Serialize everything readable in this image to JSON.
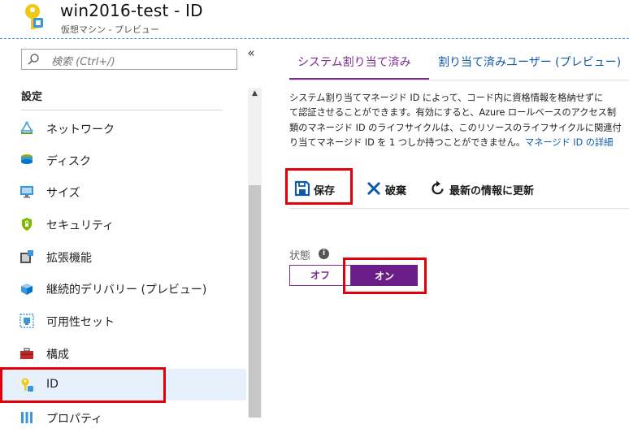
{
  "header": {
    "title": "win2016-test - ID",
    "subtitle": "仮想マシン - プレビュー",
    "icon": "key-identity-icon"
  },
  "sidebar": {
    "search_placeholder": "検索 (Ctrl+/)",
    "collapse_glyph": "«",
    "section_heading": "設定",
    "items": [
      {
        "label": "ネットワーク",
        "icon": "network-icon"
      },
      {
        "label": "ディスク",
        "icon": "disk-icon"
      },
      {
        "label": "サイズ",
        "icon": "monitor-size-icon"
      },
      {
        "label": "セキュリティ",
        "icon": "shield-icon"
      },
      {
        "label": "拡張機能",
        "icon": "extensions-icon"
      },
      {
        "label": "継続的デリバリー (プレビュー)",
        "icon": "continuous-delivery-icon"
      },
      {
        "label": "可用性セット",
        "icon": "availability-set-icon"
      },
      {
        "label": "構成",
        "icon": "toolbox-icon"
      },
      {
        "label": "ID",
        "icon": "key-icon",
        "active": true
      },
      {
        "label": "プロパティ",
        "icon": "properties-icon"
      }
    ]
  },
  "main": {
    "tabs": [
      {
        "label": "システム割り当て済み",
        "active": true
      },
      {
        "label": "割り当て済みユーザー (プレビュー)",
        "active": false
      }
    ],
    "description_lines": [
      "システム割り当てマネージド ID によって、コード内に資格情報を格納せずに",
      "て認証させることができます。有効にすると、Azure ロールベースのアクセス制",
      "類のマネージド ID のライフサイクルは、このリソースのライフサイクルに関連付",
      "り当てマネージド ID を 1 つしか持つことができません。"
    ],
    "description_link": "マネージド ID の詳細",
    "toolbar": {
      "save_label": "保存",
      "discard_label": "破棄",
      "refresh_label": "最新の情報に更新"
    },
    "status": {
      "label": "状態",
      "off_label": "オフ",
      "on_label": "オン",
      "value": "オン"
    }
  },
  "colors": {
    "accent_purple": "#7b2d8e",
    "toggle_on": "#6b1e87",
    "link_blue": "#0f5aa8",
    "highlight_red": "#e3000b",
    "active_item_bg": "#e6f1fb"
  }
}
